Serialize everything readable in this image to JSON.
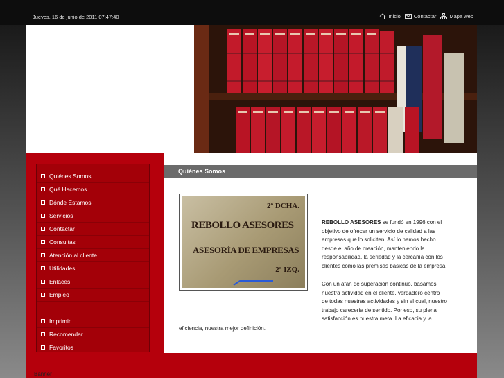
{
  "topbar": {
    "date": "Jueves, 16 de junio de 2011 07:47:40",
    "links": [
      {
        "label": "Inicio",
        "icon": "home-icon"
      },
      {
        "label": "Contactar",
        "icon": "envelope-icon"
      },
      {
        "label": "Mapa web",
        "icon": "sitemap-icon"
      }
    ]
  },
  "menu": {
    "items": [
      "Quiénes Somos",
      "Qué Hacemos",
      "Dónde Estamos",
      "Servicios",
      "Contactar",
      "Consultas",
      "Atención al cliente",
      "Utilidades",
      "Enlaces",
      "Empleo"
    ],
    "tools": [
      "Imprimir",
      "Recomendar",
      "Favoritos"
    ]
  },
  "content": {
    "section_title": "Quiénes Somos",
    "sign": {
      "top_right": "2º DCHA.",
      "line1": "REBOLLO ASESORES",
      "line2": "ASESORÍA DE EMPRESAS",
      "bottom_right": "2º IZQ."
    },
    "p1": {
      "company": "REBOLLO ASESORES",
      "lines": [
        " se fundó en 1996 con el",
        "objetivo de ofrecer un servicio de calidad a las",
        "empresas que lo soliciten. Así lo hemos hecho",
        "desde el año de creación, manteniendo la",
        "responsabilidad, la seriedad y la cercanía con los",
        "clientes como las premisas básicas de la empresa."
      ]
    },
    "p2": {
      "lines": [
        "Con un afán de superación continuo, basamos",
        "nuestra actividad en el cliente, verdadero centro",
        "de todas nuestras actividades y sin el cual, nuestro",
        "trabajo carecería de sentido. Por eso, su plena",
        "satisfacción es nuestra meta. La eficacia y la"
      ],
      "last_line": "eficiencia, nuestra mejor definición."
    }
  },
  "footer": {
    "banner": "Banner"
  }
}
